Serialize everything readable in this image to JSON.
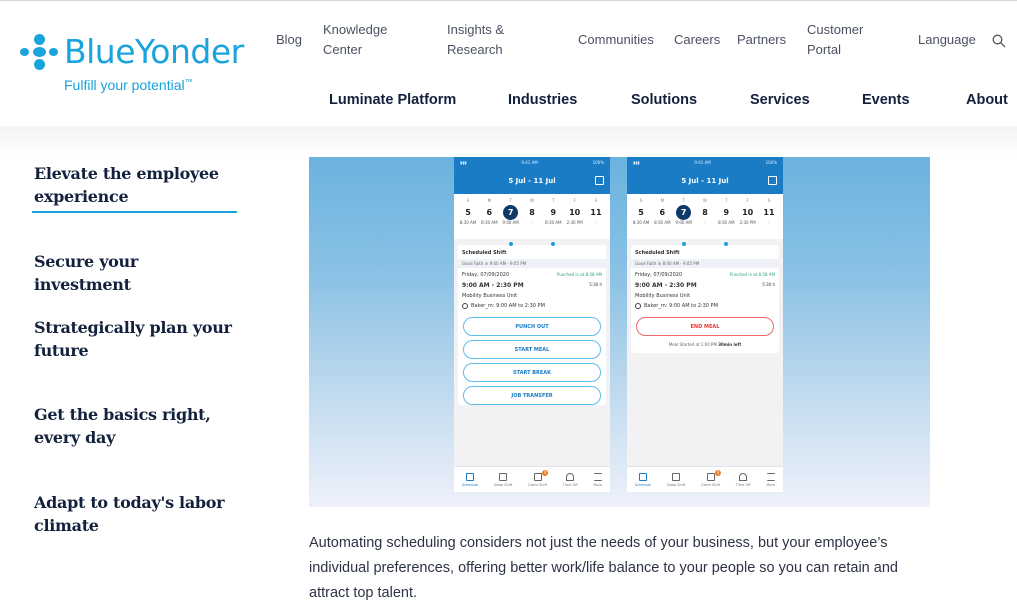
{
  "brand": {
    "name": "BlueYonder",
    "tagline": "Fulfill your potential",
    "tagline_mark": "™",
    "color": "#1aa3dc"
  },
  "utility_nav": [
    {
      "label": "Blog"
    },
    {
      "label": "Knowledge Center"
    },
    {
      "label": "Insights & Research"
    },
    {
      "label": "Communities"
    },
    {
      "label": "Careers"
    },
    {
      "label": "Partners"
    },
    {
      "label": "Customer Portal"
    },
    {
      "label": "Language"
    }
  ],
  "search_icon": "search-icon",
  "main_nav": [
    {
      "label": "Luminate Platform"
    },
    {
      "label": "Industries"
    },
    {
      "label": "Solutions"
    },
    {
      "label": "Services"
    },
    {
      "label": "Events"
    },
    {
      "label": "About"
    }
  ],
  "side_menu": {
    "active_index": 0,
    "items": [
      {
        "label": "Elevate the employee experience"
      },
      {
        "label": "Secure your investment"
      },
      {
        "label": "Strategically plan your future"
      },
      {
        "label": "Get the basics right, every day"
      },
      {
        "label": "Adapt to today's labor climate"
      }
    ]
  },
  "phones": [
    {
      "status_time": "9:41 AM",
      "battery": "100%",
      "title": "5 Jul - 11 Jul",
      "week": {
        "days": [
          "S",
          "M",
          "T",
          "W",
          "T",
          "F",
          "S"
        ],
        "dates": [
          "5",
          "6",
          "7",
          "8",
          "9",
          "10",
          "11"
        ],
        "selected_index": 2,
        "times": [
          "8:30 AM",
          "8:30 AM",
          "9:00 AM",
          "-",
          "8:30 AM",
          "2:30 PM",
          "-"
        ]
      },
      "card": {
        "heading": "Scheduled Shift",
        "subheading": "Good Faith in 9:00 AM - 9:05 PM",
        "date": "Friday, 07/09/2020",
        "punched": "Punched in at 8:58 AM",
        "hours": "9:00 AM - 2:30 PM",
        "duration": "5:30 h",
        "unit": "Mobility Business Unit",
        "person": "Baker_m: 9:00 AM to 2:30 PM"
      },
      "buttons": [
        "PUNCH OUT",
        "START MEAL",
        "START BREAK",
        "JOB TRANSFER"
      ]
    },
    {
      "status_time": "9:41 AM",
      "battery": "100%",
      "title": "5 Jul - 11 Jul",
      "week": {
        "days": [
          "S",
          "M",
          "T",
          "W",
          "T",
          "F",
          "S"
        ],
        "dates": [
          "5",
          "6",
          "7",
          "8",
          "9",
          "10",
          "11"
        ],
        "selected_index": 2,
        "times": [
          "8:30 AM",
          "8:30 AM",
          "9:00 AM",
          "-",
          "8:30 AM",
          "2:30 PM",
          "-"
        ]
      },
      "card": {
        "heading": "Scheduled Shift",
        "subheading": "Good Faith in 8:00 AM - 9:05 PM",
        "date": "Friday, 07/09/2020",
        "punched": "Punched in at 8:58 AM",
        "hours": "9:00 AM - 2:30 PM",
        "duration": "5:30 h",
        "unit": "Mobility Business Unit",
        "person": "Baker_m: 9:00 AM to 2:30 PM"
      },
      "buttons": [
        "END MEAL"
      ],
      "meal_note": "Meal Started at 1:00 PM",
      "meal_left": "30min left"
    }
  ],
  "tabbar": [
    {
      "label": "Schedule",
      "active": true
    },
    {
      "label": "Swap Shift"
    },
    {
      "label": "Claim Shift",
      "badge": "4"
    },
    {
      "label": "Time Off"
    },
    {
      "label": "More"
    }
  ],
  "body_text": "Automating scheduling considers not just the needs of your business, but your employee’s individual preferences, offering better work/life balance to your people so you can retain and attract top talent."
}
